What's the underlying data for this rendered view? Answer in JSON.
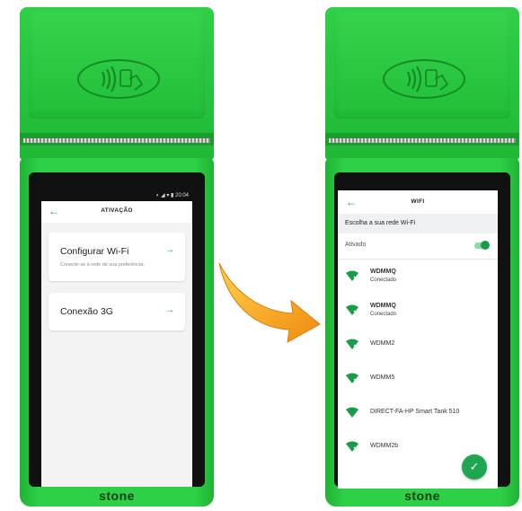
{
  "brand": "stone",
  "left_screen": {
    "status": {
      "time": "20:04"
    },
    "title": "ATIVAÇÃO",
    "cards": [
      {
        "title": "Configurar Wi-Fi",
        "subtitle": "Conecte-se à rede de sua preferência.",
        "arrow": "→"
      },
      {
        "title": "Conexão 3G",
        "subtitle": "",
        "arrow": "→"
      }
    ]
  },
  "right_screen": {
    "title": "WIFI",
    "section": "Escolha a sua rede Wi-Fi",
    "toggle": {
      "label": "Ativado",
      "on": true
    },
    "networks": [
      {
        "name": "WDMMQ",
        "status": "Conectado"
      },
      {
        "name": "WDMMQ",
        "status": "Conectado"
      },
      {
        "name": "WDMM2",
        "status": ""
      },
      {
        "name": "WDMM5",
        "status": ""
      },
      {
        "name": "DIRECT-FA-HP Smart Tank 510",
        "status": ""
      },
      {
        "name": "WDMM2b",
        "status": ""
      }
    ],
    "fab_icon": "check-icon"
  },
  "colors": {
    "device_green": "#2ed047",
    "accent": "#1a9d48"
  }
}
